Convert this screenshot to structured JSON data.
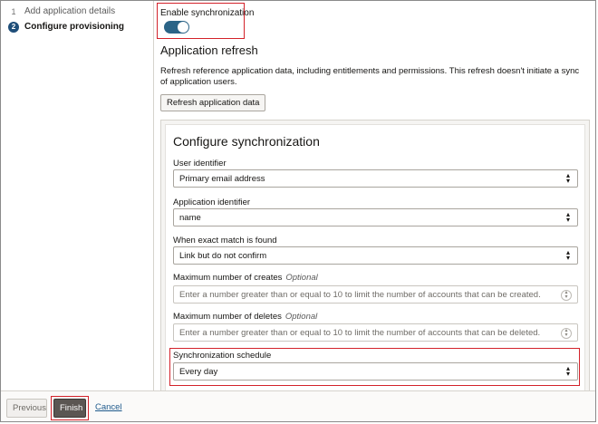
{
  "steps": [
    {
      "number": "1",
      "label": "Add application details",
      "active": false
    },
    {
      "number": "2",
      "label": "Configure provisioning",
      "active": true
    }
  ],
  "sync_toggle": {
    "label": "Enable synchronization",
    "enabled": true
  },
  "refresh": {
    "heading": "Application refresh",
    "description": "Refresh reference application data, including entitlements and permissions. This refresh doesn't initiate a sync of application users.",
    "button_label": "Refresh application data"
  },
  "config": {
    "title": "Configure synchronization",
    "user_identifier": {
      "label": "User identifier",
      "value": "Primary email address"
    },
    "application_identifier": {
      "label": "Application identifier",
      "value": "name"
    },
    "exact_match": {
      "label": "When exact match is found",
      "value": "Link but do not confirm"
    },
    "max_creates": {
      "label": "Maximum number of creates",
      "optional": "Optional",
      "placeholder": "Enter a number greater than or equal to 10 to limit the number of accounts that can be created."
    },
    "max_deletes": {
      "label": "Maximum number of deletes",
      "optional": "Optional",
      "placeholder": "Enter a number greater than or equal to 10 to limit the number of accounts that can be deleted."
    },
    "schedule": {
      "label": "Synchronization schedule",
      "value": "Every day"
    }
  },
  "footer": {
    "previous_label": "Previous",
    "finish_label": "Finish",
    "cancel_label": "Cancel"
  },
  "icons": {
    "select": "chevron-updown-icon",
    "stepper": "spinner-icon"
  },
  "colors": {
    "toggle_on": "#2b6487",
    "highlight": "#d3222a",
    "finish_button": "#5b5652",
    "link": "#1f5a8c",
    "active_step": "#1f4e79"
  }
}
